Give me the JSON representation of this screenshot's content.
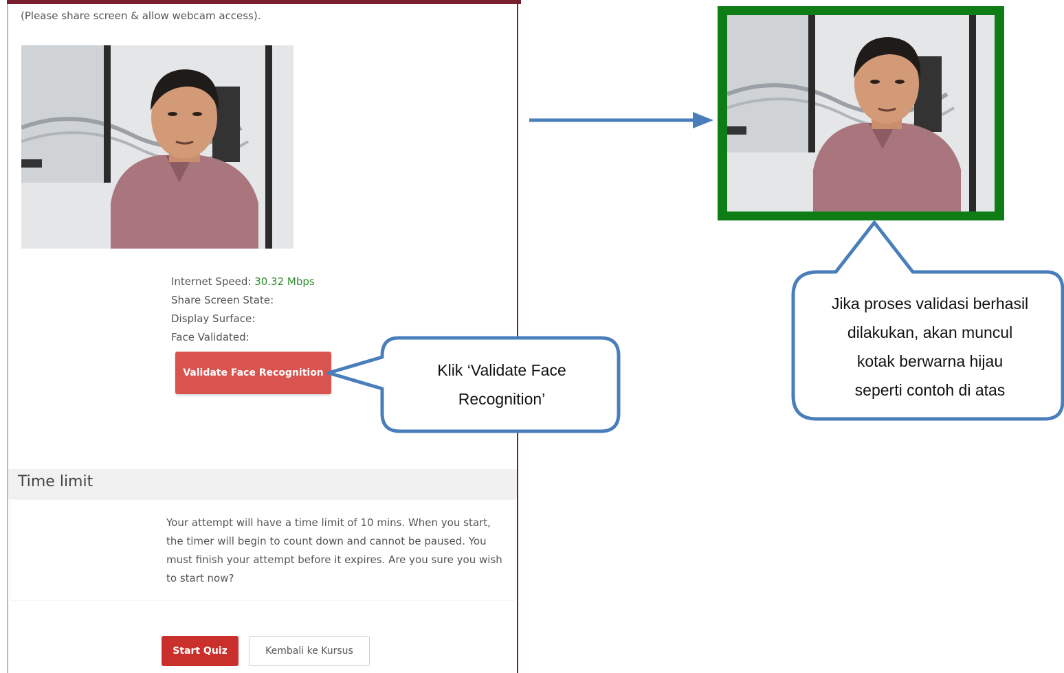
{
  "instruction": "(Please share screen & allow webcam access).",
  "status": {
    "internet_speed_label": "Internet Speed:",
    "internet_speed_value": "30.32 Mbps",
    "share_screen_label": "Share Screen State:",
    "display_surface_label": "Display Surface:",
    "face_validated_label": "Face Validated:"
  },
  "buttons": {
    "validate_face": "Validate Face Recognition",
    "start_quiz": "Start Quiz",
    "back_to_course": "Kembali ke Kursus"
  },
  "time_limit": {
    "heading": "Time limit",
    "body": "Your attempt will have a time limit of 10 mins. When you start, the timer will begin to count down and cannot be paused. You must finish your attempt before it expires. Are you sure you wish to start now?"
  },
  "callouts": {
    "validate_line1": "Klik ‘Validate Face",
    "validate_line2": "Recognition’",
    "success_line1": "Jika proses validasi berhasil",
    "success_line2": "dilakukan, akan muncul",
    "success_line3": "kotak berwarna hijau",
    "success_line4": "seperti contoh di atas"
  },
  "colors": {
    "validated_frame": "#0f7d16",
    "callout_border": "#4a7ebb",
    "arrow": "#4a7ebb",
    "danger_button": "#d9534f"
  }
}
